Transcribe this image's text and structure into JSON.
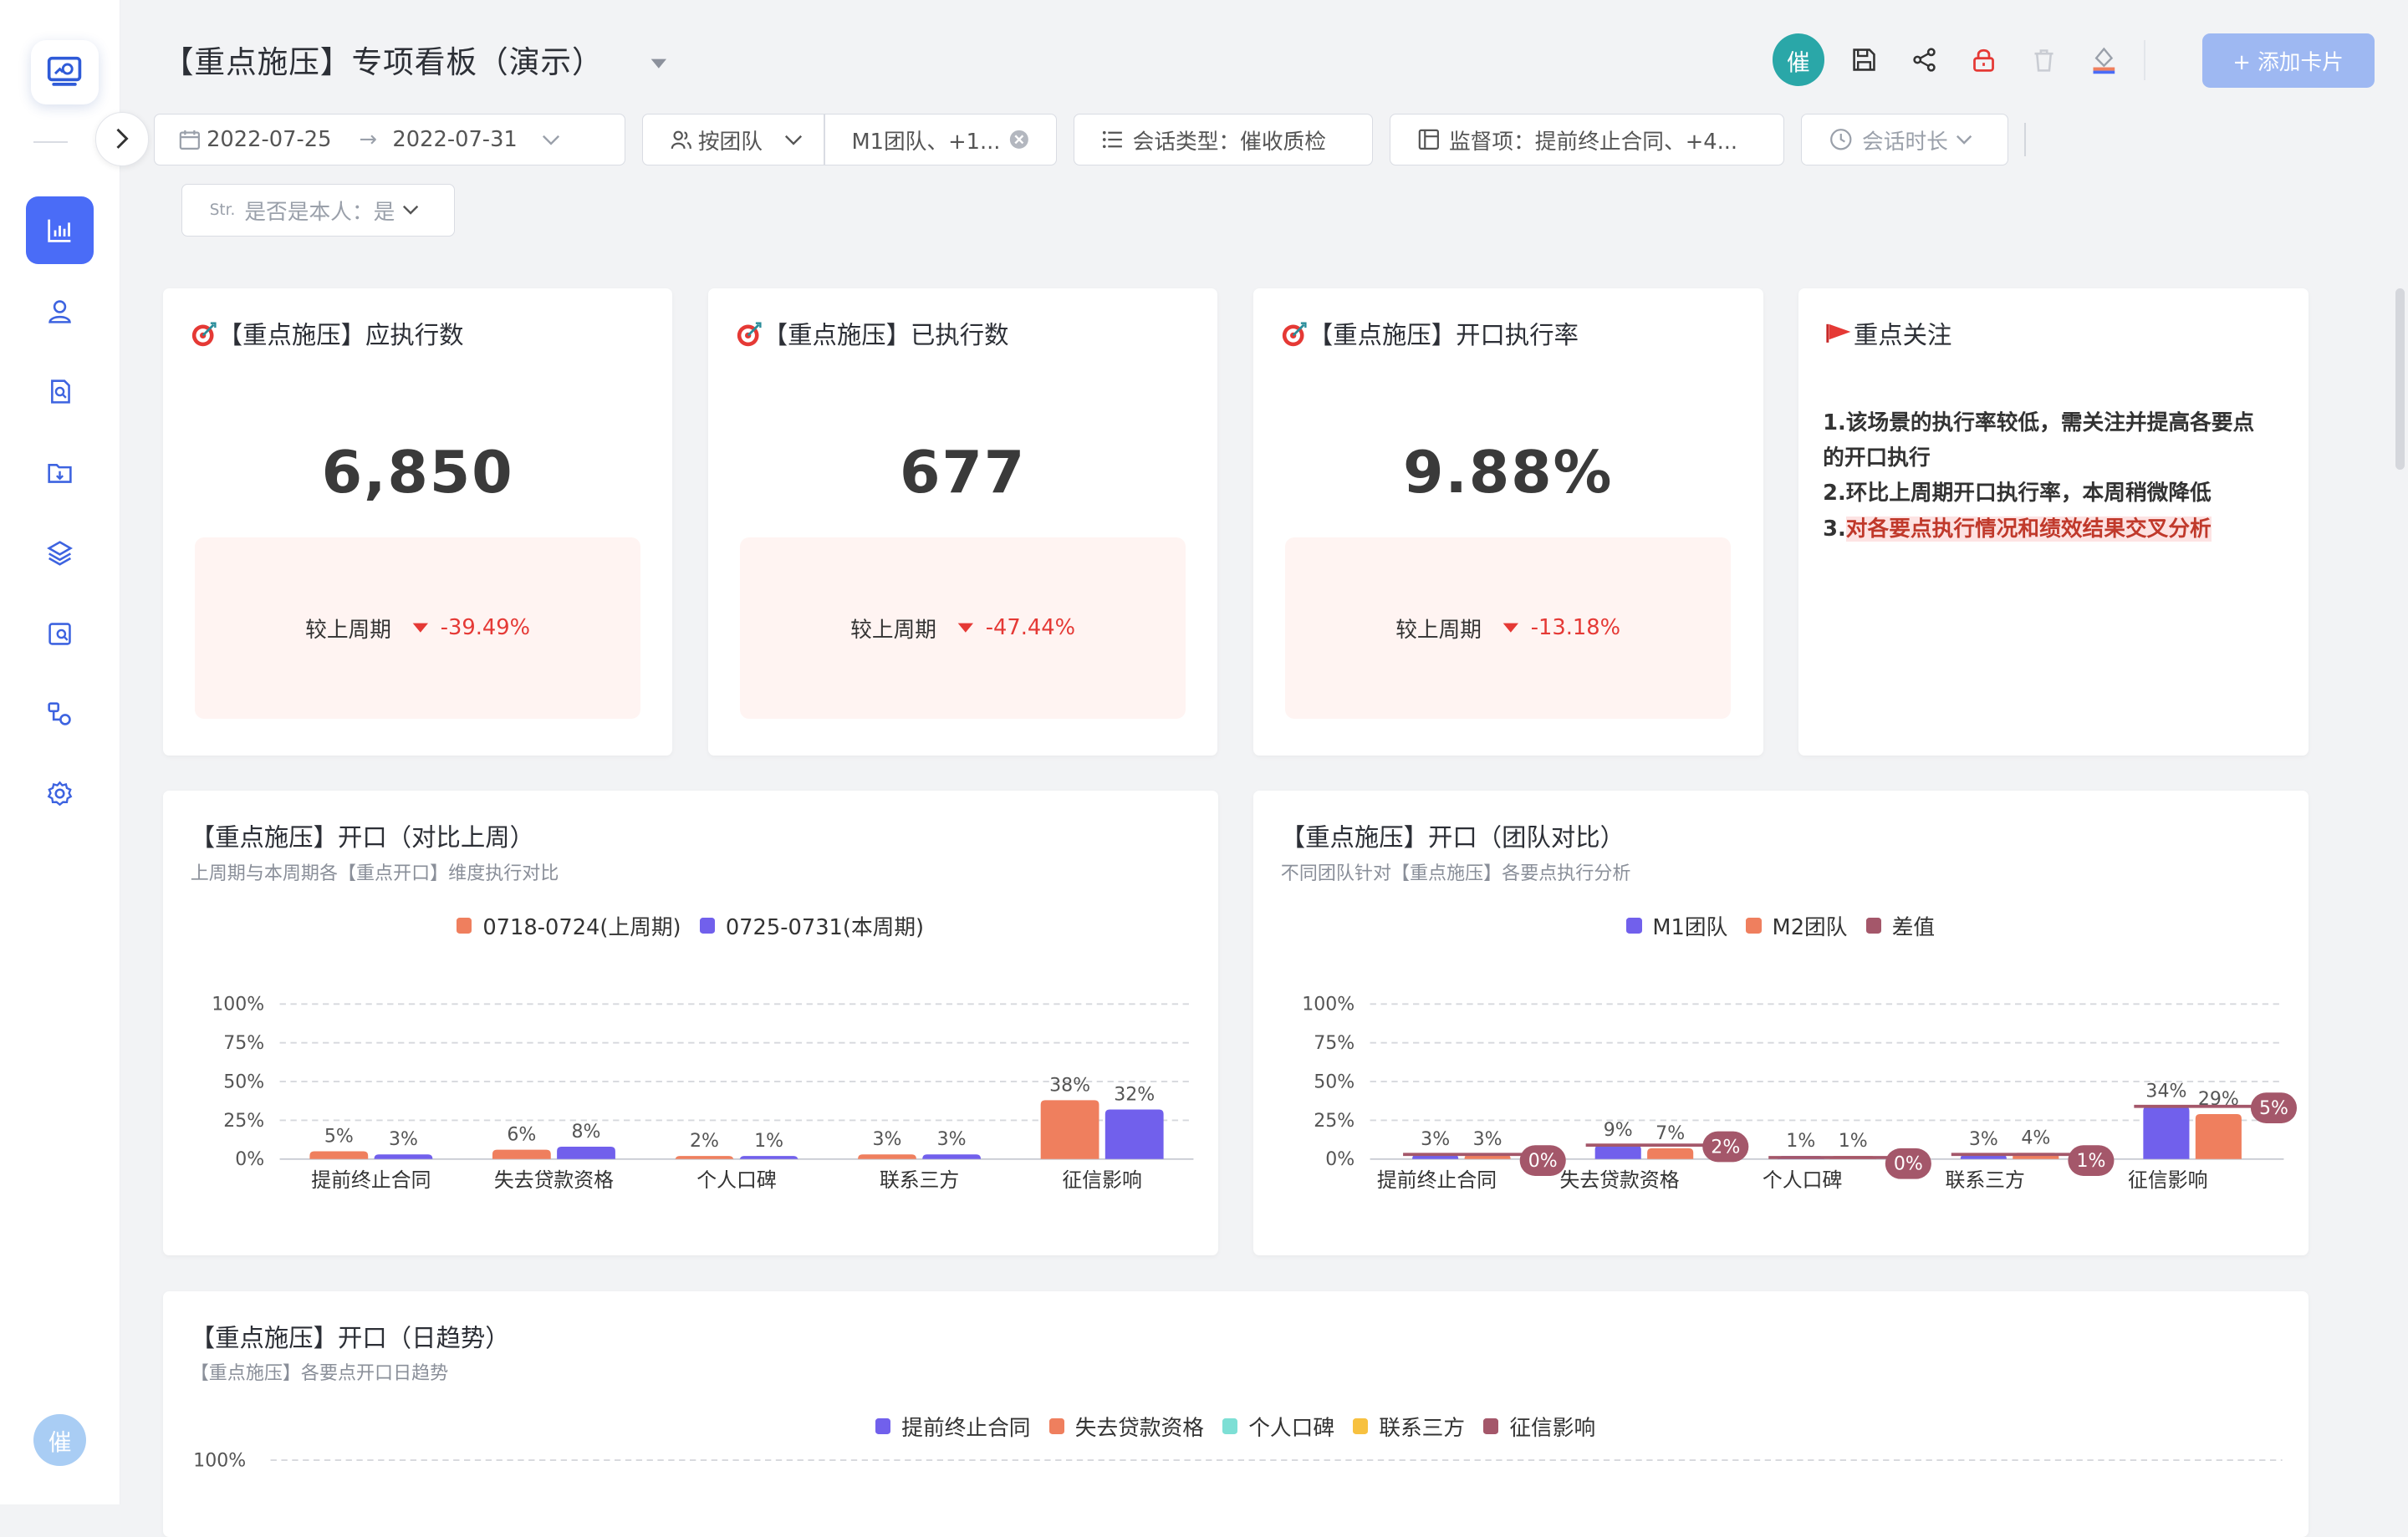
{
  "app": {
    "title": "【重点施压】专项看板（演示）",
    "user_initial": "催",
    "add_card_label": "+ 添加卡片"
  },
  "sidebar": {
    "items": [
      {
        "icon": "chart-icon",
        "active": true
      },
      {
        "icon": "user-icon"
      },
      {
        "icon": "file-search-icon"
      },
      {
        "icon": "folder-download-icon"
      },
      {
        "icon": "layers-icon"
      },
      {
        "icon": "image-search-icon"
      },
      {
        "icon": "flow-icon"
      },
      {
        "icon": "gear-icon"
      }
    ],
    "avatar": "催"
  },
  "filters": {
    "date_start": "2022-07-25",
    "date_arrow": "→",
    "date_end": "2022-07-31",
    "group_by": "按团队",
    "teams": "M1团队、+1...",
    "session_type": "会话类型：催收质检",
    "monitor": "监督项：提前终止合同、+4...",
    "duration": "会话时长",
    "is_self_prefix": "Str.",
    "is_self": "是否是本人：是"
  },
  "kpis": [
    {
      "title": "【重点施压】应执行数",
      "value": "6,850",
      "compare_label": "较上周期",
      "delta": "-39.49%"
    },
    {
      "title": "【重点施压】已执行数",
      "value": "677",
      "compare_label": "较上周期",
      "delta": "-47.44%"
    },
    {
      "title": "【重点施压】开口执行率",
      "value": "9.88%",
      "compare_label": "较上周期",
      "delta": "-13.18%"
    }
  ],
  "focus": {
    "title": "重点关注",
    "line1": "1.该场景的执行率较低，需关注并提高各要点的开口执行",
    "line2": "2.环比上周期开口执行率，本周稍微降低",
    "line3_prefix": "3.",
    "line3": "对各要点执行情况和绩效结果交叉分析"
  },
  "colors": {
    "accent": "#4a6cf7",
    "series_orange": "#ef7f5e",
    "series_purple": "#7160ec",
    "series_diff": "#a4576a",
    "series_teal": "#7ddfd5",
    "series_yellow": "#f7c140",
    "down_red": "#e53935"
  },
  "chart_data": [
    {
      "type": "bar",
      "title": "【重点施压】开口（对比上周）",
      "subtitle": "上周期与本周期各【重点开口】维度执行对比",
      "categories": [
        "提前终止合同",
        "失去贷款资格",
        "个人口碑",
        "联系三方",
        "征信影响"
      ],
      "series": [
        {
          "name": "0718-0724(上周期)",
          "values": [
            5,
            6,
            2,
            3,
            38
          ]
        },
        {
          "name": "0725-0731(本周期)",
          "values": [
            3,
            8,
            1,
            3,
            32
          ]
        }
      ],
      "yticks": [
        "100%",
        "75%",
        "50%",
        "25%",
        "0%"
      ],
      "ylim": [
        0,
        100
      ],
      "grid": true,
      "legend": "top"
    },
    {
      "type": "bar",
      "title": "【重点施压】开口（团队对比）",
      "subtitle": "不同团队针对【重点施压】各要点执行分析",
      "categories": [
        "提前终止合同",
        "失去贷款资格",
        "个人口碑",
        "联系三方",
        "征信影响"
      ],
      "series": [
        {
          "name": "M1团队",
          "values": [
            3,
            9,
            1,
            3,
            34
          ]
        },
        {
          "name": "M2团队",
          "values": [
            3,
            7,
            1,
            4,
            29
          ]
        },
        {
          "name": "差值",
          "values": [
            0,
            2,
            0,
            1,
            5
          ]
        }
      ],
      "yticks": [
        "100%",
        "75%",
        "50%",
        "25%",
        "0%"
      ],
      "ylim": [
        0,
        100
      ],
      "grid": true,
      "legend": "top"
    },
    {
      "type": "line",
      "title": "【重点施压】开口（日趋势）",
      "subtitle": "【重点施压】各要点开口日趋势",
      "series": [
        {
          "name": "提前终止合同"
        },
        {
          "name": "失去贷款资格"
        },
        {
          "name": "个人口碑"
        },
        {
          "name": "联系三方"
        },
        {
          "name": "征信影响"
        }
      ],
      "yticks": [
        "100%"
      ],
      "legend": "top"
    }
  ]
}
